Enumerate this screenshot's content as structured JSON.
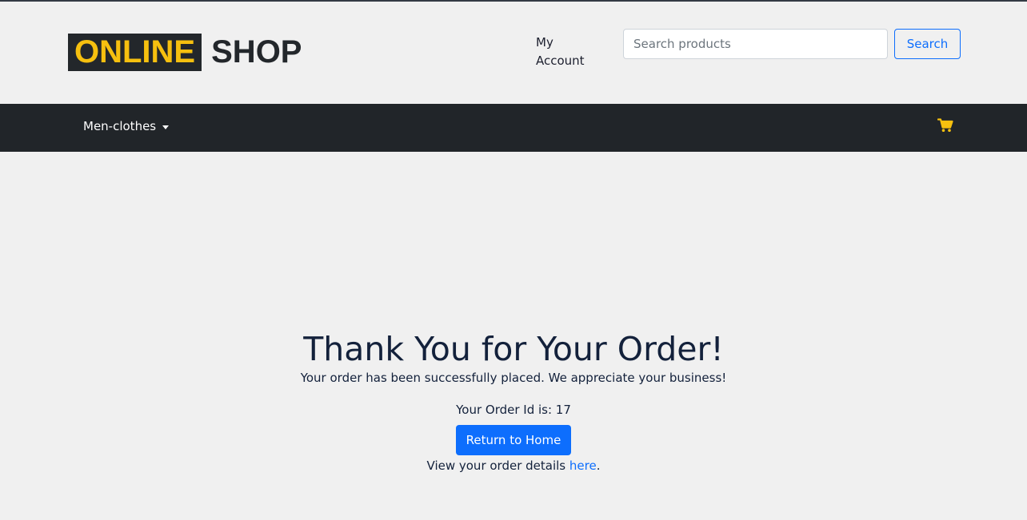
{
  "header": {
    "logo_highlight": "ONLINE",
    "logo_rest": "SHOP",
    "account_label": "My Account",
    "search_placeholder": "Search products",
    "search_button": "Search"
  },
  "navbar": {
    "dropdown_label": "Men-clothes",
    "cart_icon": "shopping-cart-icon"
  },
  "confirmation": {
    "title": "Thank You for Your Order!",
    "message": "Your order has been successfully placed. We appreciate your business!",
    "order_id_text": "Your Order Id is: 17",
    "home_button": "Return to Home",
    "details_prefix": "View your order details ",
    "details_link": "here",
    "details_suffix": "."
  },
  "colors": {
    "accent": "#f6c00f",
    "primary": "#0d6efd",
    "navbar_bg": "#212529",
    "page_bg": "#f0f0f0"
  }
}
